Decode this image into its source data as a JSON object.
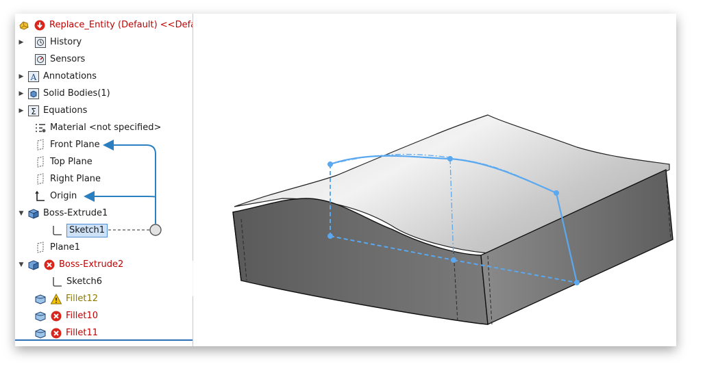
{
  "tree": {
    "root": {
      "label": "Replace_Entity (Default) <<Defau"
    },
    "items": [
      {
        "label": "History"
      },
      {
        "label": "Sensors"
      },
      {
        "label": "Annotations"
      },
      {
        "label": "Solid Bodies(1)"
      },
      {
        "label": "Equations"
      },
      {
        "label": "Material <not specified>"
      },
      {
        "label": "Front Plane"
      },
      {
        "label": "Top Plane"
      },
      {
        "label": "Right Plane"
      },
      {
        "label": "Origin"
      },
      {
        "label": "Boss-Extrude1"
      },
      {
        "label": "Sketch1"
      },
      {
        "label": "Plane1"
      },
      {
        "label": "Boss-Extrude2"
      },
      {
        "label": "Sketch6"
      },
      {
        "label": "Fillet12"
      },
      {
        "label": "Fillet10"
      },
      {
        "label": "Fillet11"
      }
    ]
  },
  "colors": {
    "error": "#c00000",
    "warning": "#e0b000",
    "selection": "#cde2f7",
    "connector": "#2a7fc0",
    "sketch": "#5aa8f0"
  }
}
